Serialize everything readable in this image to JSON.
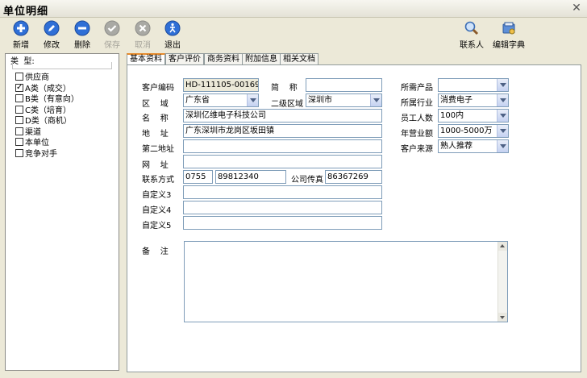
{
  "window": {
    "title": "单位明细",
    "close_glyph": "✕"
  },
  "toolbar": {
    "new_label": "新增",
    "edit_label": "修改",
    "delete_label": "删除",
    "save_label": "保存",
    "cancel_label": "取消",
    "exit_label": "退出",
    "contacts_label": "联系人",
    "dictionary_label": "编辑字典"
  },
  "sidebar": {
    "header": "类  型:",
    "items": [
      {
        "label": "供应商",
        "checked": false
      },
      {
        "label": "A类（成交）",
        "checked": true
      },
      {
        "label": "B类（有意向）",
        "checked": false
      },
      {
        "label": "C类（培育）",
        "checked": false
      },
      {
        "label": "D类（商机）",
        "checked": false
      },
      {
        "label": "渠道",
        "checked": false
      },
      {
        "label": "本单位",
        "checked": false
      },
      {
        "label": "竞争对手",
        "checked": false
      }
    ]
  },
  "tabs": [
    "基本资料",
    "客户评价",
    "商务资料",
    "附加信息",
    "相关文档"
  ],
  "form": {
    "customer_code_label": "客户编码",
    "customer_code": "HD-111105-00169",
    "short_name_label": "简    称",
    "short_name": "",
    "region_label": "区    域",
    "region": "广东省",
    "sub_region_label": "二级区域",
    "sub_region": "深圳市",
    "name_label": "名    称",
    "name": "深圳亿维电子科技公司",
    "address_label": "地    址",
    "address": "广东深圳市龙岗区坂田镇",
    "address2_label": "第二地址",
    "address2": "",
    "website_label": "网    址",
    "website": "",
    "phone_label": "联系方式",
    "phone_area": "0755",
    "phone_number": "89812340",
    "fax_label": "公司传真",
    "fax": "86367269",
    "custom3_label": "自定义3",
    "custom3": "",
    "custom4_label": "自定义4",
    "custom4": "",
    "custom5_label": "自定义5",
    "custom5": "",
    "memo_label": "备    注",
    "memo": "",
    "product_label": "所需产品",
    "product": "",
    "industry_label": "所属行业",
    "industry": "消费电子",
    "employees_label": "员工人数",
    "employees": "100内",
    "revenue_label": "年营业额",
    "revenue": "1000-5000万",
    "source_label": "客户来源",
    "source": "熟人推荐"
  }
}
